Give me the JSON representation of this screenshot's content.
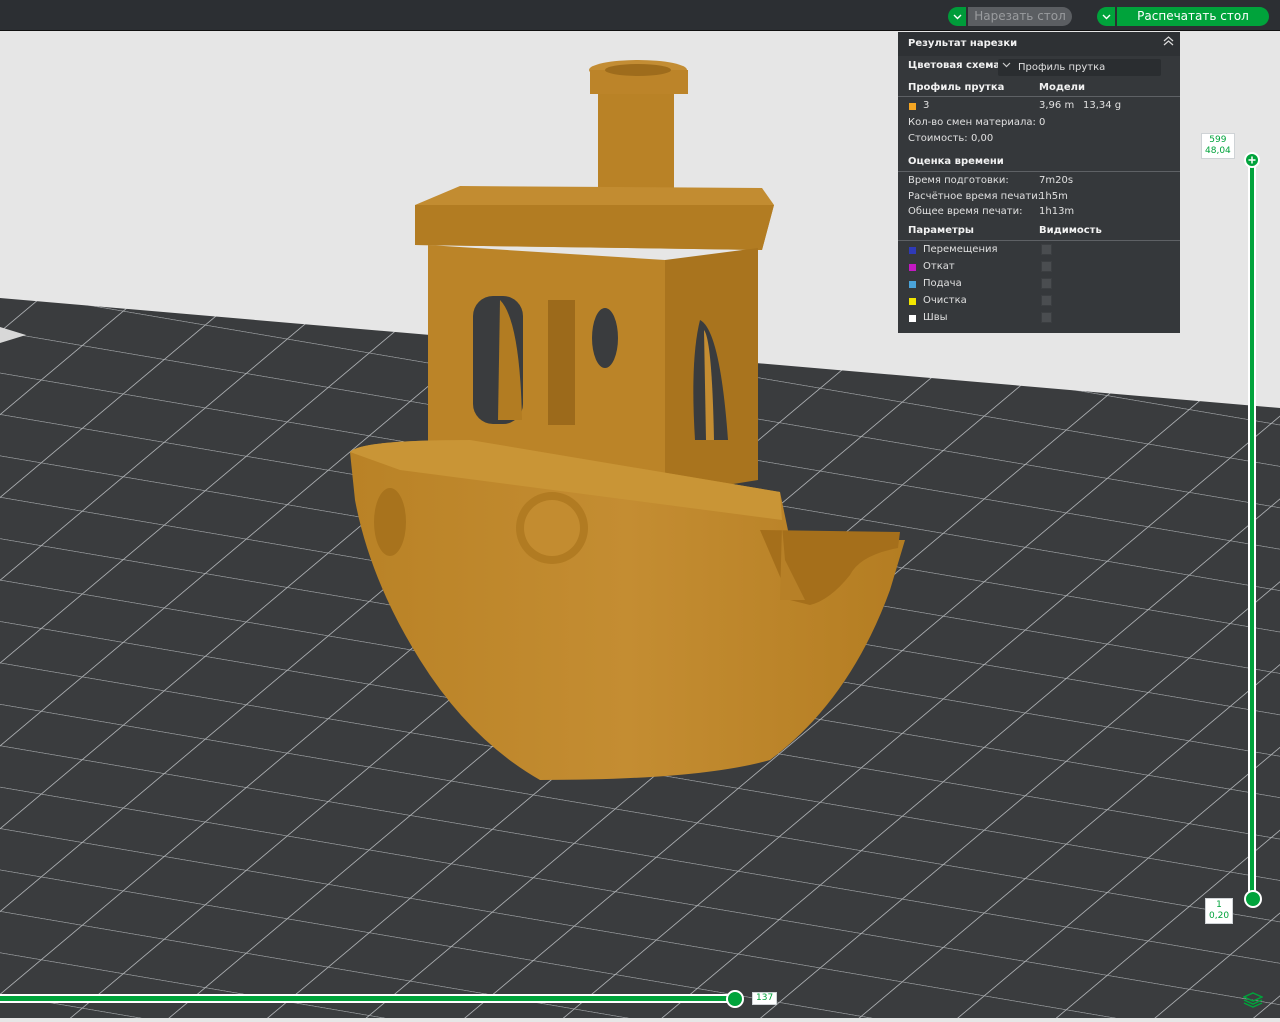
{
  "toolbar": {
    "slice_label": "Нарезать стол",
    "print_label": "Распечатать стол"
  },
  "panel": {
    "title": "Результат нарезки",
    "color_scheme_label": "Цветовая схема",
    "color_scheme_value": "Профиль прутка",
    "filament_header": "Профиль прутка",
    "models_header": "Модели",
    "filament": {
      "color": "#f5a623",
      "name": "3",
      "length": "3,96 m",
      "weight": "13,34 g"
    },
    "material_changes_label": "Кол-во смен материала:",
    "material_changes_value": "0",
    "cost_label": "Стоимость:",
    "cost_value": "0,00",
    "time_title": "Оценка времени",
    "prep_label": "Время подготовки:",
    "prep_value": "7m20s",
    "est_label": "Расчётное время печати:",
    "est_value": "1h5m",
    "total_label": "Общее время печати:",
    "total_value": "1h13m",
    "params_header": "Параметры",
    "visibility_header": "Видимость",
    "params": [
      {
        "label": "Перемещения",
        "color": "#2f3ab8"
      },
      {
        "label": "Откат",
        "color": "#c419c4"
      },
      {
        "label": "Подача",
        "color": "#4aa3d9"
      },
      {
        "label": "Очистка",
        "color": "#f2e600"
      },
      {
        "label": "Швы",
        "color": "#ffffff"
      }
    ]
  },
  "layer_slider": {
    "top_layer": "599",
    "top_height": "48,04",
    "bottom_layer": "1",
    "bottom_height": "0,20"
  },
  "move_slider": {
    "value": "137"
  },
  "colors": {
    "accent": "#00a33b",
    "model": "#bf8a2f",
    "bed": "#3a3c3e",
    "bed_lines": "#b9bcbf"
  }
}
